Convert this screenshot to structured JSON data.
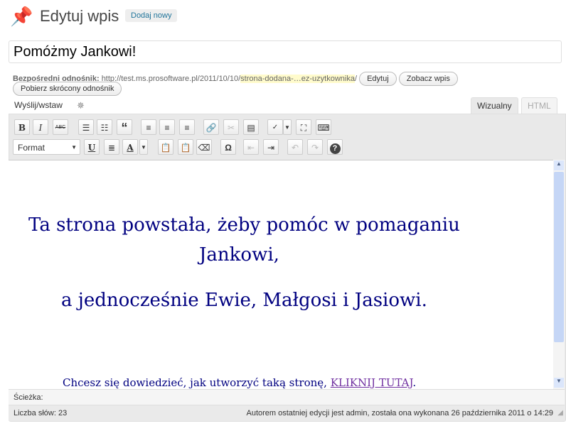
{
  "header": {
    "title": "Edytuj wpis",
    "add_new": "Dodaj nowy"
  },
  "post_title": "Pomóżmy Jankowi!",
  "permalink": {
    "label": "Bezpośredni odnośnik:",
    "base": "http://test.ms.prosoftware.pl/2011/10/10/",
    "slug": "strona-dodana-…ez-uzytkownika",
    "trail": "/",
    "edit": "Edytuj",
    "view": "Zobacz wpis",
    "shortlink": "Pobierz skrócony odnośnik"
  },
  "upload": {
    "label": "Wyślij/wstaw"
  },
  "tabs": {
    "visual": "Wizualny",
    "html": "HTML"
  },
  "toolbar": {
    "format": "Format",
    "bold": "B",
    "italic": "I",
    "strike": "ABC",
    "quote": "“",
    "underline": "U",
    "color": "A",
    "omega": "Ω",
    "help": "?"
  },
  "content": {
    "line1": "Ta strona powstała, żeby pomóc w pomaganiu",
    "line2": "Jankowi,",
    "line3": "a jednocześnie Ewie, Małgosi i Jasiowi.",
    "line4": "Chcesz się dowiedzieć, jak utworzyć taką stronę, ",
    "link": "KLIKNIJ TUTAJ",
    "end": "."
  },
  "path": {
    "label": "Ścieżka:"
  },
  "status": {
    "words": "Liczba słów: 23",
    "last_edit": "Autorem ostatniej edycji jest admin, została ona wykonana 26 października 2011 o 14:29"
  }
}
